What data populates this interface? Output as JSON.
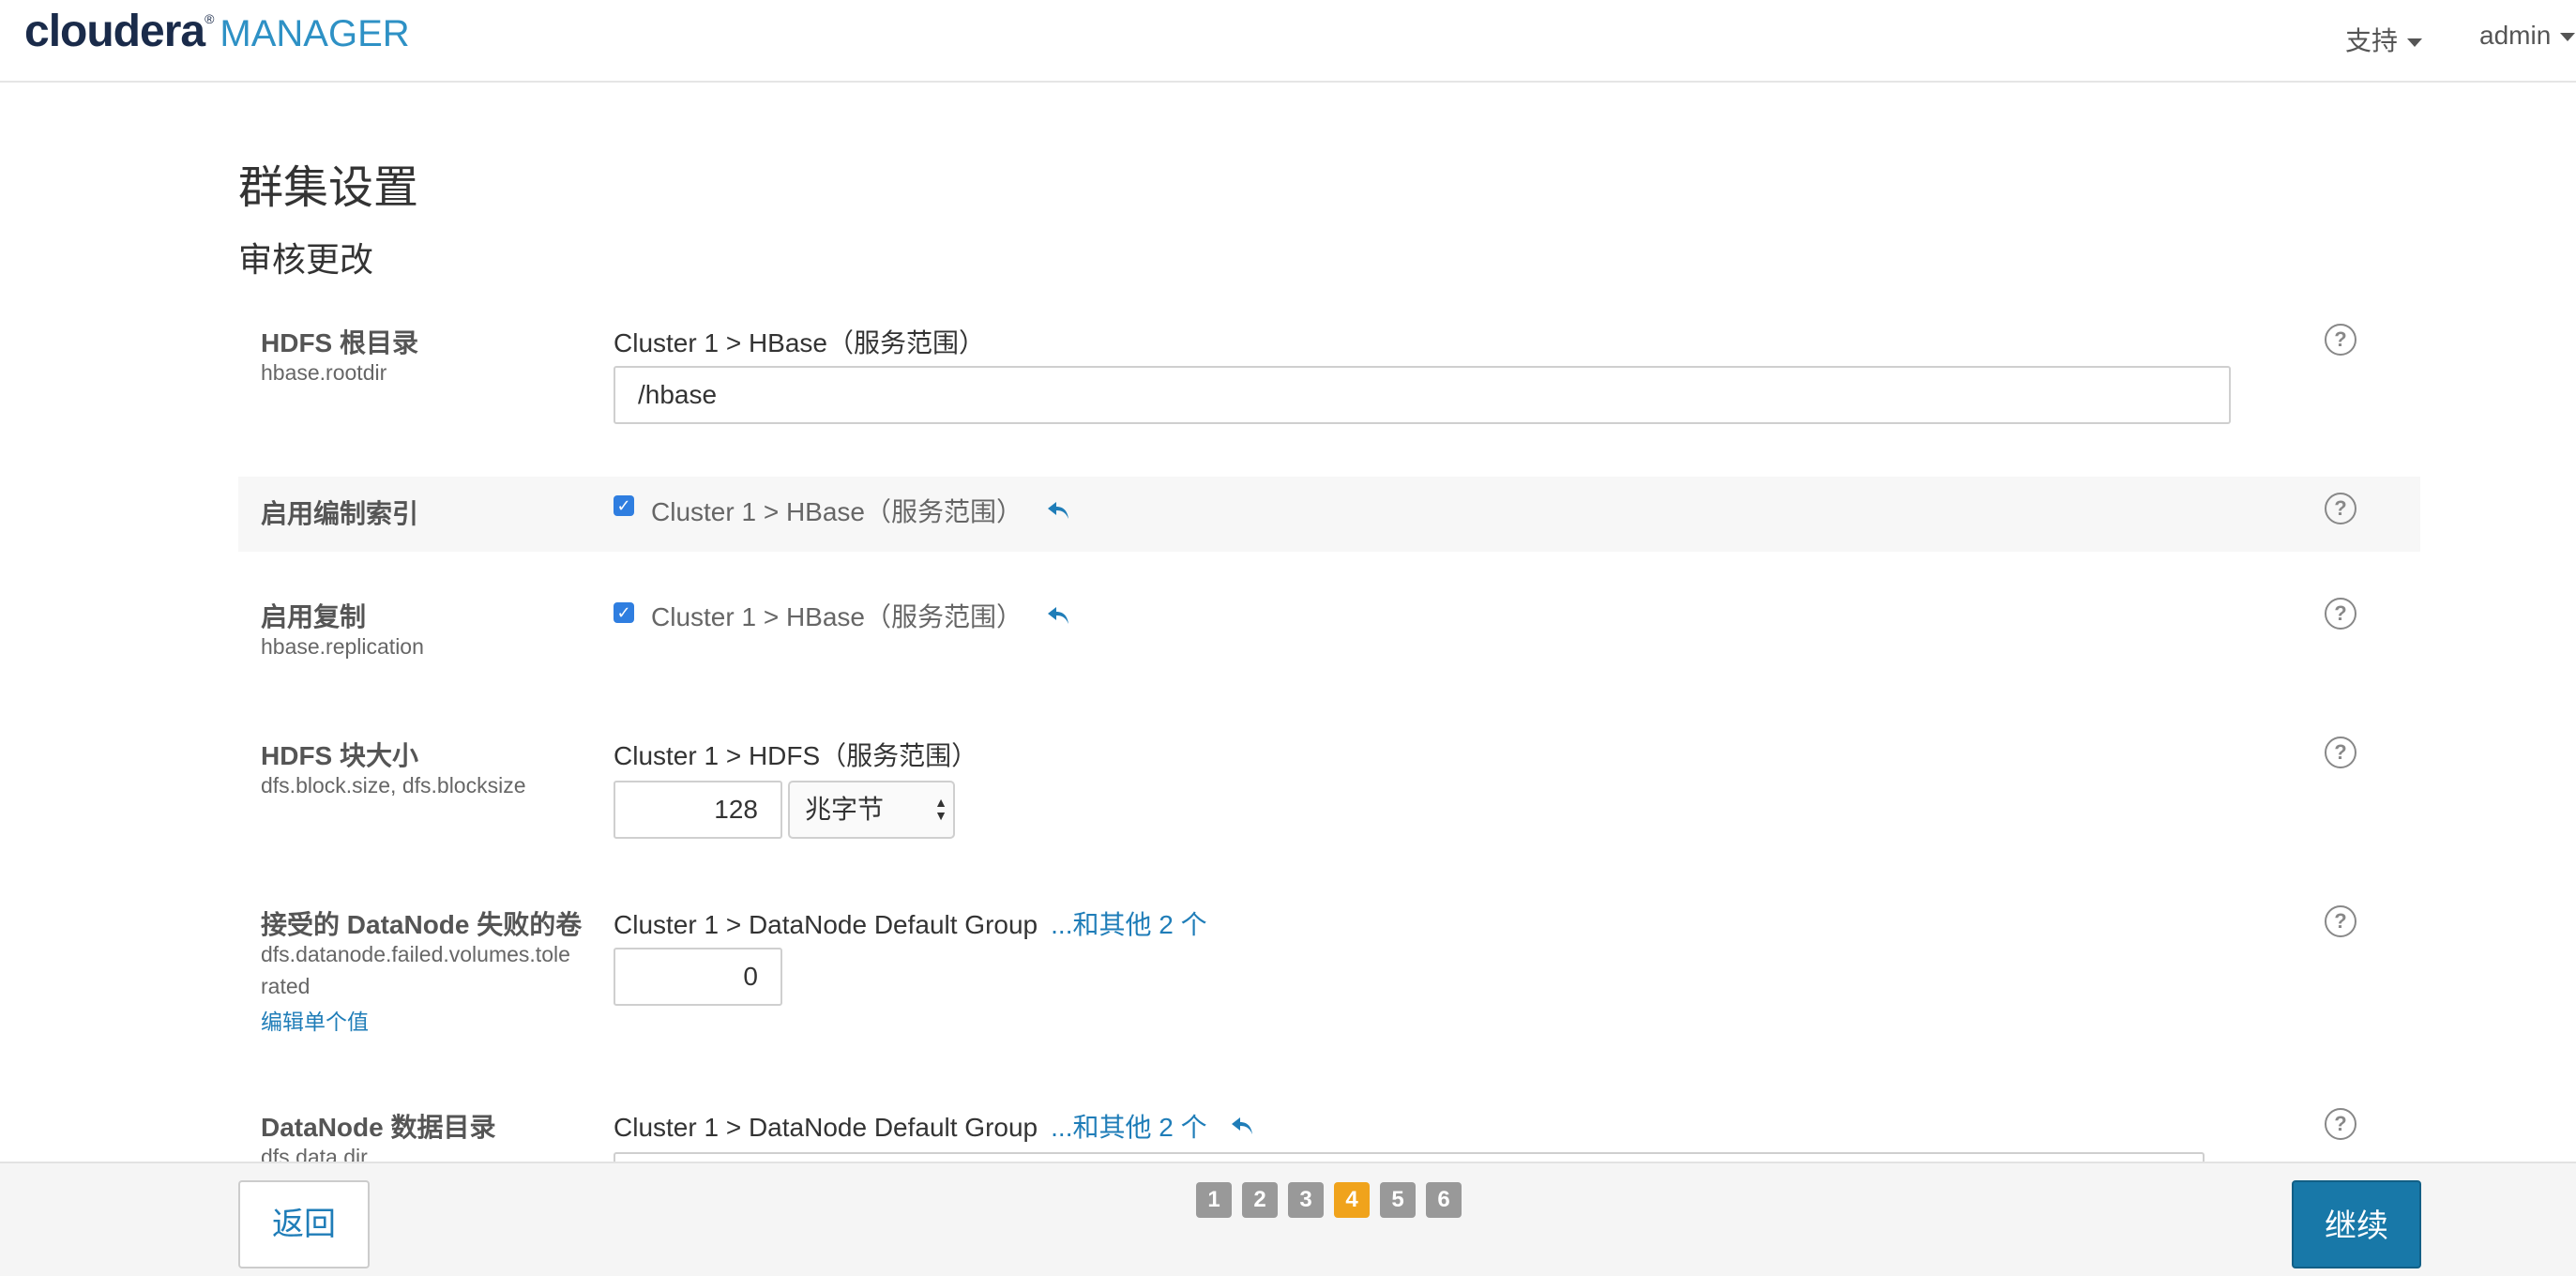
{
  "header": {
    "logo_main": "cloudera",
    "logo_reg": "®",
    "logo_sub": "MANAGER",
    "support_label": "支持",
    "user_label": "admin"
  },
  "page": {
    "title": "群集设置",
    "subtitle": "审核更改"
  },
  "settings": [
    {
      "label": "HDFS 根目录",
      "key": "hbase.rootdir",
      "scope": "Cluster 1 > HBase（服务范围）",
      "value": "/hbase"
    },
    {
      "label": "启用编制索引",
      "scope": "Cluster 1 > HBase（服务范围）",
      "checked": true
    },
    {
      "label": "启用复制",
      "key": "hbase.replication",
      "scope": "Cluster 1 > HBase（服务范围）",
      "checked": true
    },
    {
      "label": "HDFS 块大小",
      "key": "dfs.block.size, dfs.blocksize",
      "scope": "Cluster 1 > HDFS（服务范围）",
      "value": "128",
      "unit": "兆字节"
    },
    {
      "label": "接受的 DataNode 失败的卷",
      "key_line1": "dfs.datanode.failed.volumes.tole",
      "key_line2": "rated",
      "edit_link": "编辑单个值",
      "scope": "Cluster 1 > DataNode Default Group",
      "more_link": "...和其他 2 个",
      "value": "0"
    },
    {
      "label": "DataNode 数据目录",
      "key": "dfs.data.dir",
      "scope": "Cluster 1 > DataNode Default Group",
      "more_link": "...和其他 2 个"
    }
  ],
  "footer": {
    "back_label": "返回",
    "continue_label": "继续",
    "pages": [
      "1",
      "2",
      "3",
      "4",
      "5",
      "6"
    ],
    "current_page": "4"
  },
  "colors": {
    "brand_dark": "#1a2b4a",
    "brand_blue": "#2e91c5",
    "link": "#1f7db8",
    "primary_button": "#1878a8",
    "active_page": "#f0a31c",
    "checkbox": "#2f7ee0"
  },
  "icons": {
    "help": "question-circle-icon",
    "revert": "undo-arrow-icon",
    "caret": "caret-down-icon",
    "checkbox": "checkmark-icon"
  }
}
